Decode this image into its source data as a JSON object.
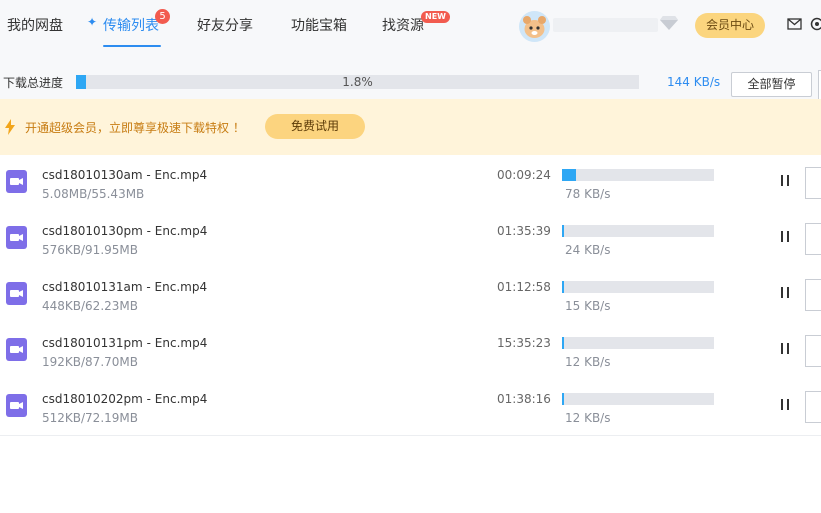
{
  "nav": {
    "items": [
      "我的网盘",
      "传输列表",
      "好友分享",
      "功能宝箱",
      "找资源"
    ],
    "active_index": 1,
    "transfer_badge": "5",
    "resources_badge": "NEW"
  },
  "user": {
    "vip_label": "会员中心"
  },
  "download_progress": {
    "label": "下载总进度",
    "percent_text": "1.8%",
    "fraction": 0.018,
    "speed": "144 KB/s",
    "pause_all_label": "全部暂停"
  },
  "promo": {
    "text": "开通超级会员，立即尊享极速下载特权 ！",
    "trial_label": "免费试用"
  },
  "files": [
    {
      "name": "csd18010130am - Enc.mp4",
      "size": "5.08MB/55.43MB",
      "eta": "00:09:24",
      "speed": "78 KB/s",
      "progress": 0.0916
    },
    {
      "name": "csd18010130pm - Enc.mp4",
      "size": "576KB/91.95MB",
      "eta": "01:35:39",
      "speed": "24 KB/s",
      "progress": 0.0061
    },
    {
      "name": "csd18010131am - Enc.mp4",
      "size": "448KB/62.23MB",
      "eta": "01:12:58",
      "speed": "15 KB/s",
      "progress": 0.007
    },
    {
      "name": "csd18010131pm - Enc.mp4",
      "size": "192KB/87.70MB",
      "eta": "15:35:23",
      "speed": "12 KB/s",
      "progress": 0.0021
    },
    {
      "name": "csd18010202pm - Enc.mp4",
      "size": "512KB/72.19MB",
      "eta": "01:38:16",
      "speed": "12 KB/s",
      "progress": 0.0069
    }
  ],
  "colors": {
    "accent": "#2d8cf0",
    "progress": "#2ea7f4",
    "vip": "#fbd57e",
    "promo_bg": "#fff4da",
    "video_icon": "#7e6ee8",
    "badge": "#f25b4f"
  }
}
